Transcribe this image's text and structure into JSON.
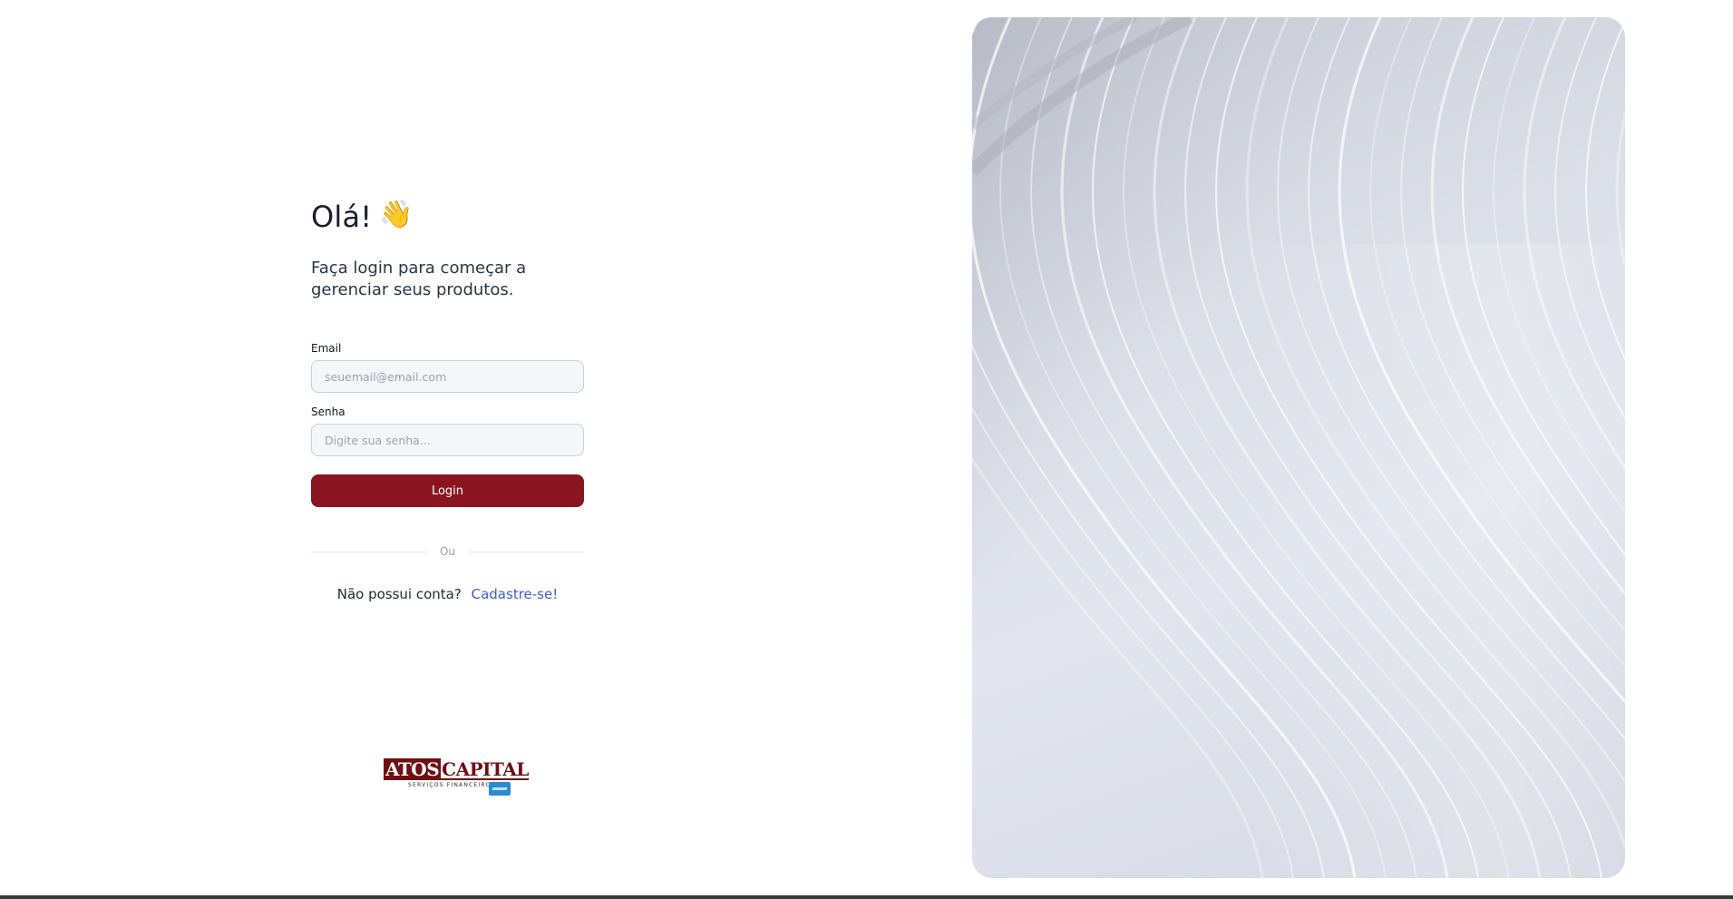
{
  "login": {
    "greeting": "Olá!",
    "greeting_emoji": "👋",
    "subtitle": "Faça login para começar a gerenciar seus produtos.",
    "email_label": "Email",
    "email_placeholder": "seuemail@email.com",
    "password_label": "Senha",
    "password_placeholder": "Digite sua senha...",
    "login_button": "Login",
    "divider_text": "Ou",
    "no_account_text": "Não possui conta?",
    "signup_link": "Cadastre-se!"
  },
  "logo": {
    "brand_part1": "ATOS",
    "brand_part2": "CAPITAL",
    "tagline": "SERVIÇOS FINANCEIROS"
  },
  "colors": {
    "primary": "#8a1520",
    "link": "#3b5fd0",
    "brand": "#6e0f14"
  },
  "icons": {
    "greeting": "waving-hand-icon"
  }
}
